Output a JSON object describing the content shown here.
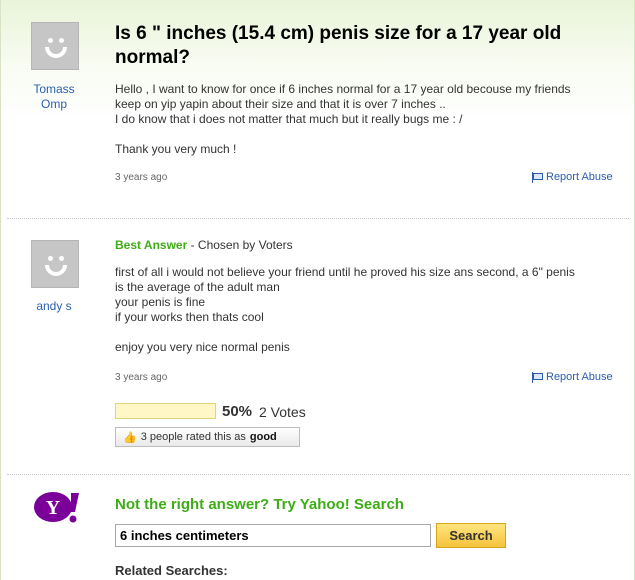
{
  "question": {
    "author": "Tomass Omp",
    "title": "Is 6 \" inches (15.4 cm) penis size for a 17 year old normal?",
    "lines": [
      "Hello , I want to know for once if 6 inches normal for a 17 year old becouse my friends",
      "keep on yip yapin about their size and that it is over 7 inches ..",
      "I do know that i does not matter that much but it really bugs me : /",
      "",
      "Thank you very much !"
    ],
    "timestamp": "3 years ago",
    "report_label": "Report Abuse"
  },
  "answer": {
    "best_label": "Best Answer",
    "chosen_by": " - Chosen by Voters",
    "author": "andy s",
    "lines": [
      "first of all i would not believe your friend until he proved his size ans second, a 6\" penis",
      "is the average of the adult man",
      "your penis is fine",
      "if your works then thats cool",
      "",
      "enjoy you very nice normal penis"
    ],
    "timestamp": "3 years ago",
    "report_label": "Report Abuse",
    "vote_fraction": 0.5,
    "vote_percent": "50%",
    "vote_count": "2 Votes",
    "rated_prefix": "3 people rated this as",
    "rated_value": "good"
  },
  "search": {
    "heading": "Not the right answer? Try Yahoo! Search",
    "query": "6 inches centimeters",
    "button_label": "Search",
    "related_label": "Related Searches:"
  },
  "colors": {
    "link": "#2a5db0",
    "accent_green": "#3eac17",
    "yahoo_purple": "#7b0099"
  },
  "icons": [
    "avatar-placeholder",
    "flag-icon",
    "thumbs-up-icon",
    "yahoo-logo"
  ]
}
